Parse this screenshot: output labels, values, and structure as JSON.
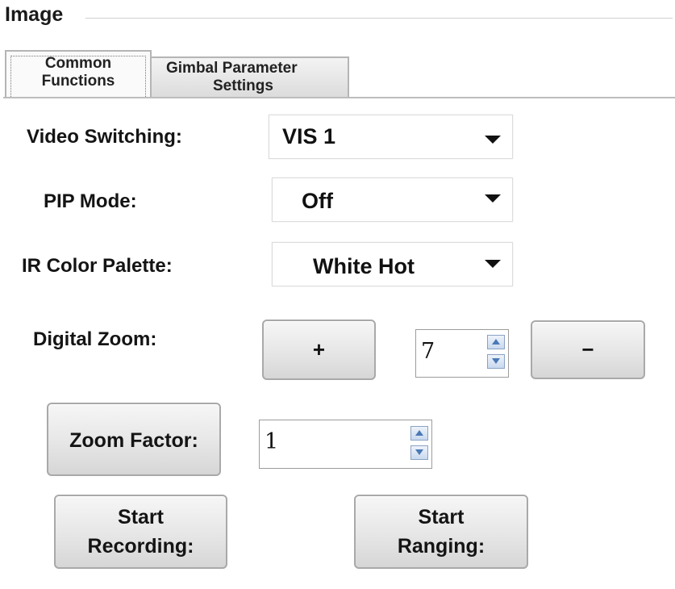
{
  "group": {
    "title": "Image"
  },
  "tabs": [
    {
      "line1": "Common",
      "line2": "Functions",
      "active": true
    },
    {
      "line1": "Gimbal Parameter",
      "line2": "Settings",
      "active": false
    }
  ],
  "video_switching": {
    "label": "Video Switching:",
    "value": "VIS 1"
  },
  "pip_mode": {
    "label": "PIP Mode:",
    "value": "Off"
  },
  "ir_palette": {
    "label": "IR Color Palette:",
    "value": "White Hot"
  },
  "digital_zoom": {
    "label": "Digital Zoom:",
    "plus": "+",
    "minus": "−",
    "value": "7"
  },
  "zoom_factor": {
    "label": "Zoom Factor:",
    "value": "1"
  },
  "start_recording": {
    "line1": "Start",
    "line2": "Recording:"
  },
  "start_ranging": {
    "line1": "Start",
    "line2": "Ranging:"
  },
  "icons": {
    "combo_arrow": "caret-down-icon",
    "spin_up": "spin-up-arrow-icon",
    "spin_down": "spin-down-arrow-icon"
  }
}
